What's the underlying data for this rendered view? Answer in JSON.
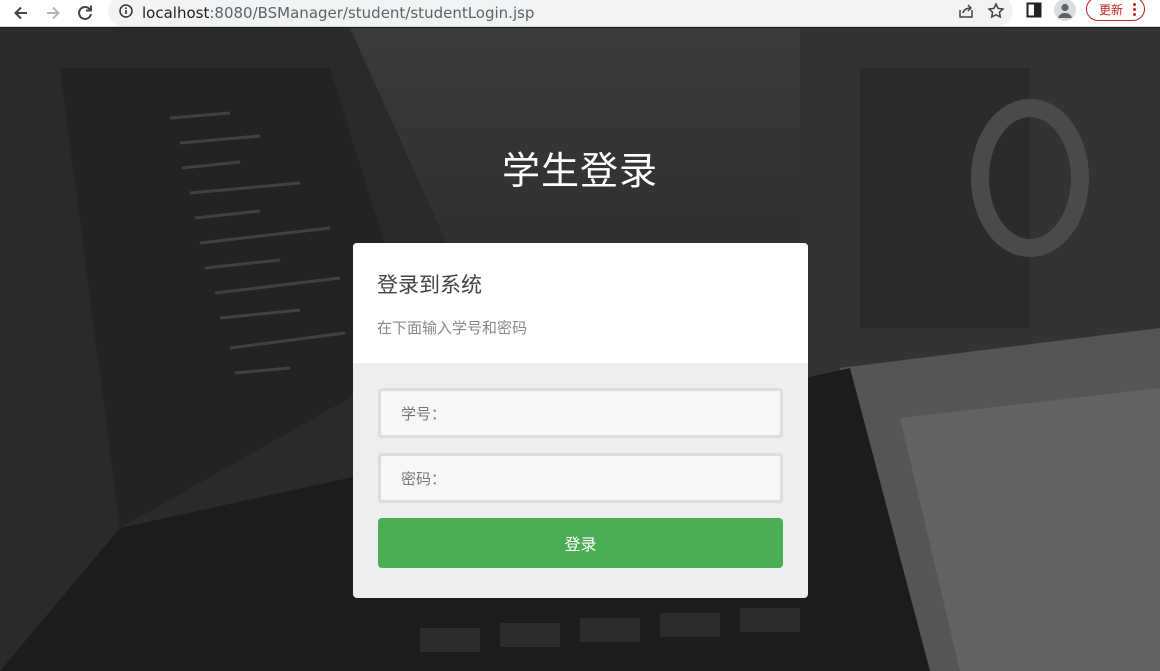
{
  "browser": {
    "url_host": "localhost",
    "url_path": ":8080/BSManager/student/studentLogin.jsp",
    "update_label": "更新"
  },
  "page": {
    "title": "学生登录"
  },
  "card": {
    "heading": "登录到系统",
    "subheading": "在下面输入学号和密码",
    "student_id_label": "学号：",
    "password_label": "密码：",
    "submit_label": "登录"
  },
  "colors": {
    "accent": "#4aae54",
    "update": "#c5221f"
  }
}
